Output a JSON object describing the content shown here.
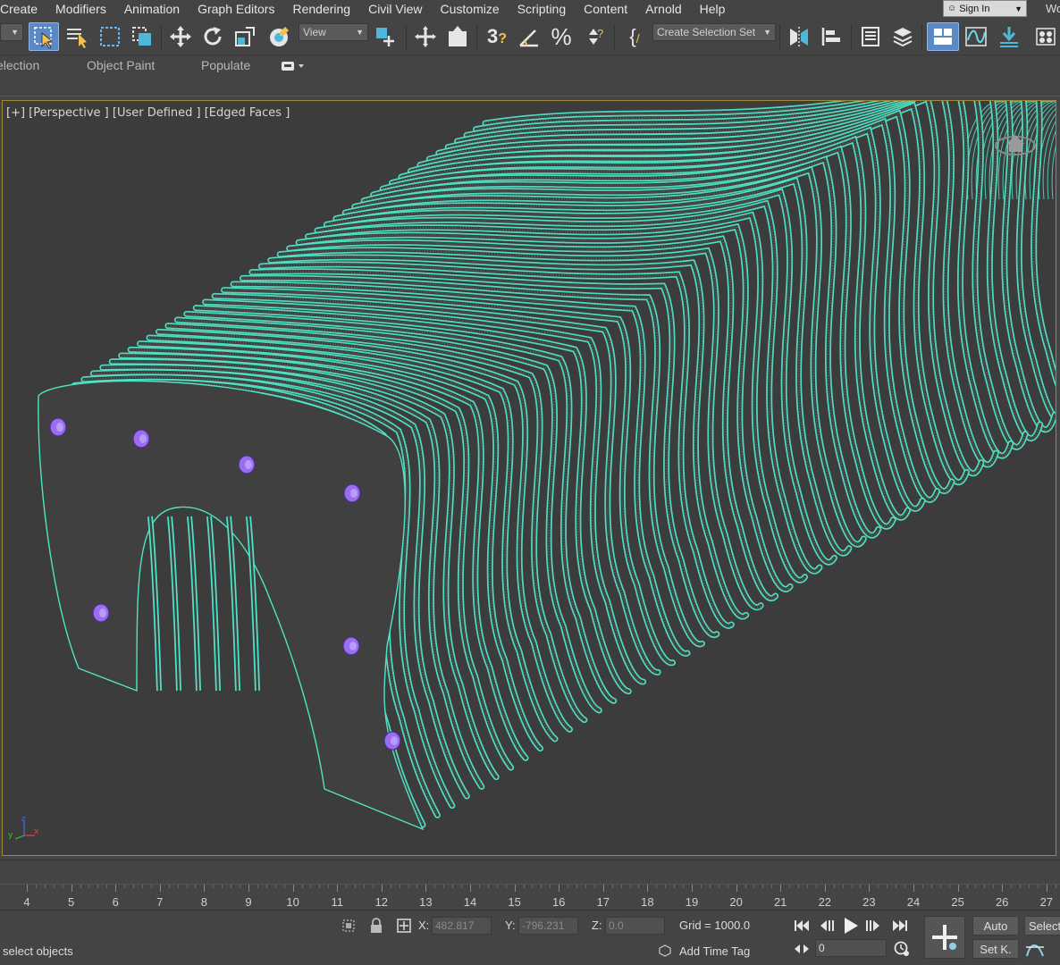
{
  "menu": {
    "items": [
      "Create",
      "Modifiers",
      "Animation",
      "Graph Editors",
      "Rendering",
      "Civil View",
      "Customize",
      "Scripting",
      "Content",
      "Arnold",
      "Help"
    ],
    "signin_label": "Sign In",
    "workspace_partial": "Wo"
  },
  "toolbar": {
    "view_dropdown": "View",
    "selection_set_dropdown": "Create Selection Set"
  },
  "ribbon": {
    "tabs": [
      "election",
      "Object Paint",
      "Populate"
    ]
  },
  "viewport": {
    "label": "[+] [Perspective ] [User Defined ] [Edged Faces ]",
    "wire_color": "#4fe3c5",
    "bolt_color": "#9a6cf0",
    "background": "#3c3c3c",
    "border_color": "#a08a3a"
  },
  "timeline": {
    "frame_labels": [
      "4",
      "5",
      "6",
      "7",
      "8",
      "9",
      "10",
      "11",
      "12",
      "13",
      "14",
      "15",
      "16",
      "17",
      "18",
      "19",
      "20",
      "21",
      "22",
      "23",
      "24",
      "25",
      "26",
      "27"
    ]
  },
  "status": {
    "prompt": "select objects",
    "x_label": "X:",
    "x_value": "482.817",
    "y_label": "Y:",
    "y_value": "-796.231",
    "z_label": "Z:",
    "z_value": "0.0",
    "grid": "Grid = 1000.0",
    "add_time_tag": "Add Time Tag",
    "auto_label": "Auto",
    "set_key_label": "Set K.",
    "selected_partial": "Selecte",
    "frame_value": "0"
  }
}
